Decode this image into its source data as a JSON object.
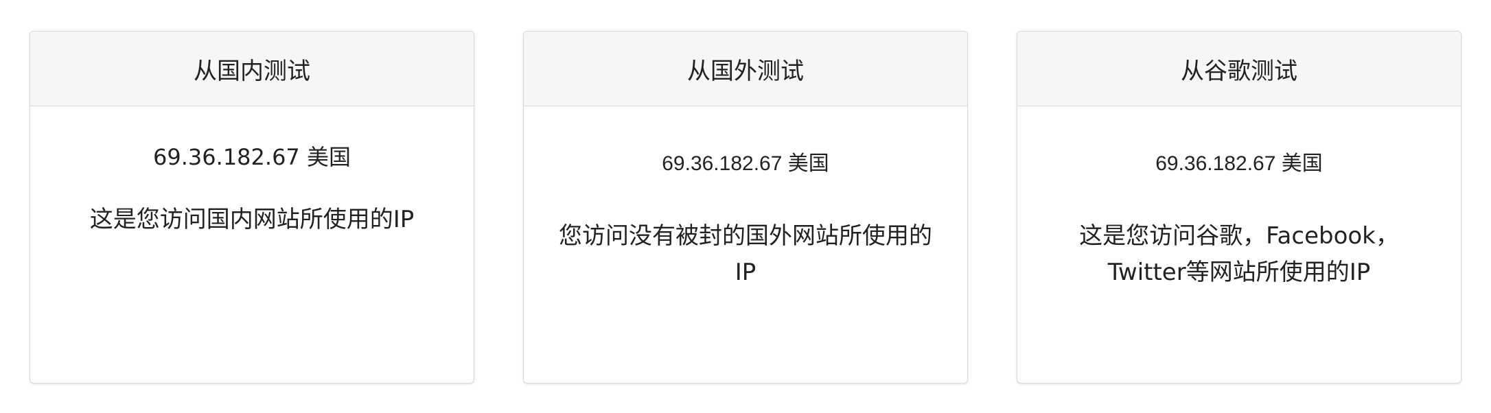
{
  "cards": [
    {
      "title": "从国内测试",
      "ip": "69.36.182.67 美国",
      "description": "这是您访问国内网站所使用的IP"
    },
    {
      "title": "从国外测试",
      "ip": "69.36.182.67 美国",
      "description": "您访问没有被封的国外网站所使用的IP"
    },
    {
      "title": "从谷歌测试",
      "ip": "69.36.182.67 美国",
      "description": "这是您访问谷歌，Facebook，Twitter等网站所使用的IP"
    }
  ]
}
